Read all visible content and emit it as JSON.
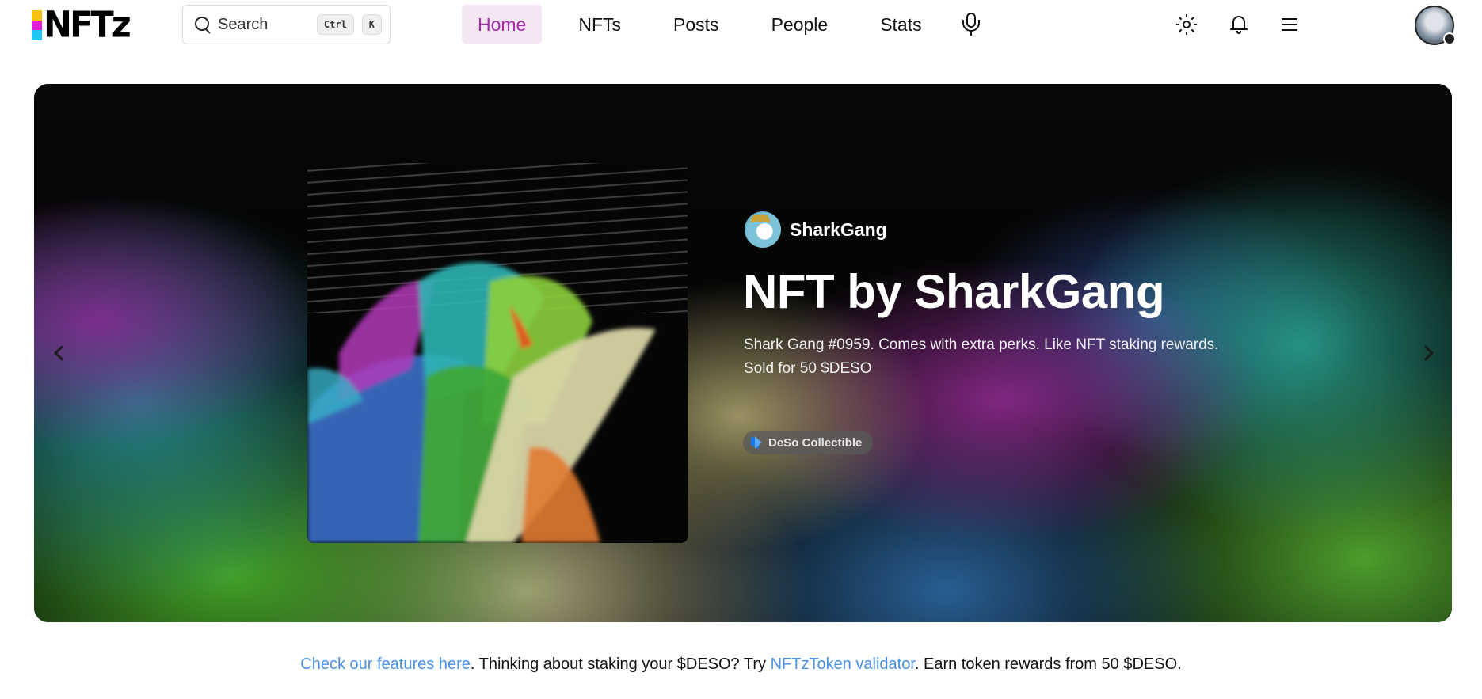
{
  "header": {
    "logo_text": "NFTz",
    "search": {
      "label": "Search",
      "shortcut_keys": [
        "Ctrl",
        "K"
      ]
    },
    "nav": [
      {
        "label": "Home",
        "active": true
      },
      {
        "label": "NFTs",
        "active": false
      },
      {
        "label": "Posts",
        "active": false
      },
      {
        "label": "People",
        "active": false
      },
      {
        "label": "Stats",
        "active": false
      }
    ],
    "icons": [
      "microphone-icon",
      "sun-icon",
      "bell-icon",
      "menu-icon"
    ]
  },
  "hero": {
    "creator_name": "SharkGang",
    "title": "NFT by SharkGang",
    "description": "Shark Gang #0959. Comes with extra perks. Like NFT staking rewards.",
    "sold_text": "Sold for 50 $DESO",
    "badge_label": "DeSo Collectible"
  },
  "promo": {
    "link1": "Check our features here",
    "text1": ". Thinking about staking your $DESO? Try ",
    "link2": "NFTzToken validator",
    "text2": ". Earn token rewards from 50 $DESO."
  },
  "colors": {
    "nav_active_bg": "#f5e6f5",
    "nav_active_text": "#a42ca8",
    "link": "#4a90e2",
    "logo_yellow": "#f5c211",
    "logo_magenta": "#e21fd8",
    "logo_cyan": "#1fc7f5"
  }
}
